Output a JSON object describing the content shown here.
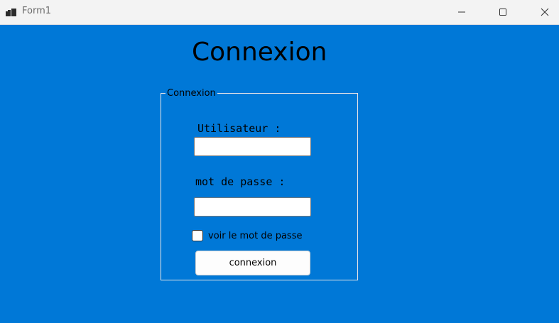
{
  "window": {
    "title": "Form1",
    "icon": "winforms-app-icon",
    "controls": [
      "minimize-icon",
      "maximize-icon",
      "close-icon"
    ]
  },
  "form": {
    "heading": "Connexion",
    "group_label": "Connexion",
    "username_label": "Utilisateur :",
    "username_value": "",
    "password_label": "mot de passe :",
    "password_value": "",
    "show_password_label": "voir le mot de passe",
    "show_password_checked": false,
    "submit_label": "connexion"
  },
  "colors": {
    "background": "#0078d7",
    "titlebar": "#f3f3f3",
    "text": "#000000"
  }
}
